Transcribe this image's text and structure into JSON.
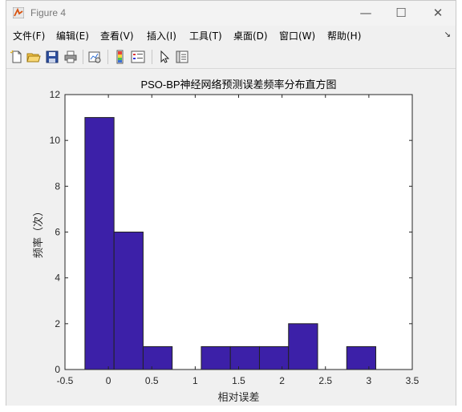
{
  "window": {
    "title": "Figure 4",
    "minimize_glyph": "—",
    "maximize_glyph": "☐",
    "close_glyph": "✕"
  },
  "menu": {
    "items": [
      "文件(F)",
      "编辑(E)",
      "查看(V)",
      "插入(I)",
      "工具(T)",
      "桌面(D)",
      "窗口(W)",
      "帮助(H)"
    ],
    "overflow_glyph": "↘"
  },
  "toolbar": {
    "icons": [
      "new-figure-icon",
      "open-file-icon",
      "save-icon",
      "print-icon",
      "link-plot-icon",
      "insert-colorbar-icon",
      "insert-legend-icon",
      "edit-plot-arrow-icon",
      "property-inspector-icon"
    ]
  },
  "colors": {
    "bar_fill": "#3c20a8",
    "bar_edge": "#222222",
    "axes_bg": "#ffffff",
    "figure_bg": "#f0f0f0"
  },
  "chart_data": {
    "type": "bar",
    "title": "PSO-BP神经网络预测误差频率分布直方图",
    "xlabel": "相对误差",
    "ylabel": "频率（次）",
    "xlim": [
      -0.5,
      3.5
    ],
    "ylim": [
      0,
      12
    ],
    "xticks": [
      -0.5,
      0,
      0.5,
      1,
      1.5,
      2,
      2.5,
      3,
      3.5
    ],
    "xtick_labels": [
      "-0.5",
      "0",
      "0.5",
      "1",
      "1.5",
      "2",
      "2.5",
      "3",
      "3.5"
    ],
    "yticks": [
      0,
      2,
      4,
      6,
      8,
      10,
      12
    ],
    "ytick_labels": [
      "0",
      "2",
      "4",
      "6",
      "8",
      "10",
      "12"
    ],
    "bin_edges": [
      -0.27,
      0.065,
      0.4,
      0.735,
      1.07,
      1.405,
      1.74,
      2.075,
      2.41,
      2.745,
      3.08
    ],
    "values": [
      11,
      6,
      1,
      0,
      1,
      1,
      1,
      2,
      0,
      1
    ],
    "grid": false
  }
}
